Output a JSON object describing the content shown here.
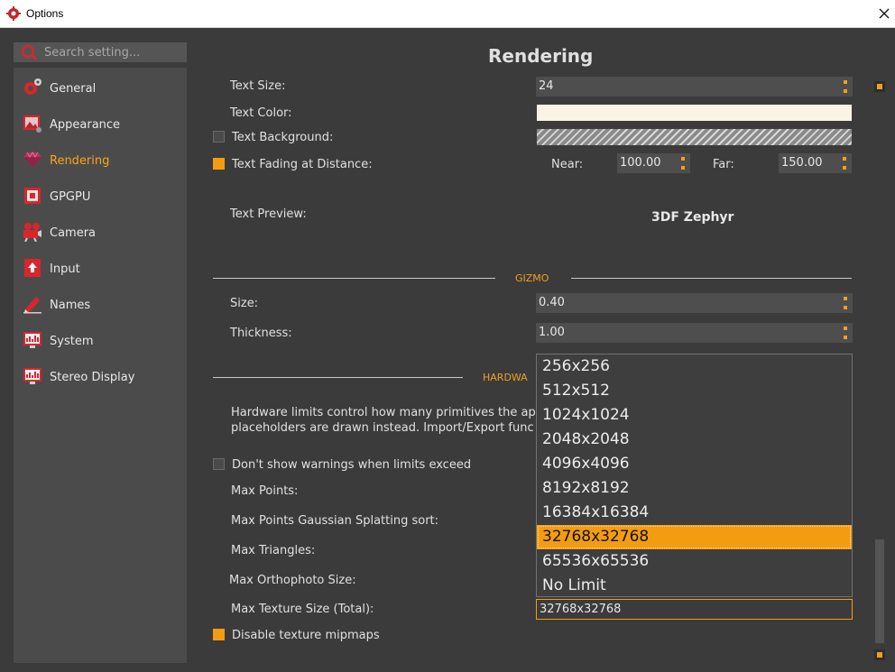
{
  "window": {
    "title": "Options",
    "close_glyph": "✕"
  },
  "search": {
    "placeholder": "Search setting..."
  },
  "sidebar": {
    "items": [
      {
        "label": "General",
        "icon": "gear-icon"
      },
      {
        "label": "Appearance",
        "icon": "picture-icon"
      },
      {
        "label": "Rendering",
        "icon": "gem-icon"
      },
      {
        "label": "GPGPU",
        "icon": "chip-icon"
      },
      {
        "label": "Camera",
        "icon": "camera-icon"
      },
      {
        "label": "Input",
        "icon": "arrow-up-icon"
      },
      {
        "label": "Names",
        "icon": "pencil-icon"
      },
      {
        "label": "System",
        "icon": "monitor-chart-icon"
      },
      {
        "label": "Stereo Display",
        "icon": "monitor-chart-icon"
      }
    ],
    "active": "Rendering"
  },
  "page": {
    "heading": "Rendering"
  },
  "text_settings": {
    "text_size_label": "Text Size:",
    "text_size_value": "24",
    "text_color_label": "Text Color:",
    "text_background_label": "Text Background:",
    "text_background_checked": false,
    "text_fading_label": "Text Fading at Distance:",
    "text_fading_checked": true,
    "near_label": "Near:",
    "near_value": "100.00",
    "far_label": "Far:",
    "far_value": "150.00",
    "preview_label": "Text Preview:",
    "preview_text": "3DF Zephyr"
  },
  "gizmo": {
    "section_label": "GIZMO",
    "size_label": "Size:",
    "size_value": "0.40",
    "thickness_label": "Thickness:",
    "thickness_value": "1.00"
  },
  "hardware": {
    "section_label": "HARDWA",
    "description_line1": "Hardware limits control how many primitives the ap",
    "description_line2": "placeholders are drawn instead. Import/Export func",
    "dont_show_label": "Don't show warnings when limits exceed",
    "dont_show_checked": false,
    "max_points_label": "Max Points:",
    "max_points_gs_label": "Max Points Gaussian Splatting sort:",
    "max_triangles_label": "Max Triangles:",
    "max_ortho_label": "Max Orthophoto Size:",
    "max_texture_label": "Max Texture Size (Total):",
    "max_texture_value": "32768x32768",
    "disable_mipmaps_label": "Disable texture mipmaps",
    "disable_mipmaps_checked": true
  },
  "dropdown": {
    "options": [
      "256x256",
      "512x512",
      "1024x1024",
      "2048x2048",
      "4096x4096",
      "8192x8192",
      "16384x16384",
      "32768x32768",
      "65536x65536",
      "No Limit"
    ],
    "selected": "32768x32768"
  },
  "colors": {
    "accent": "#f39c12",
    "text_color_swatch": "#faf4e6",
    "background": "#3b3b3b"
  }
}
